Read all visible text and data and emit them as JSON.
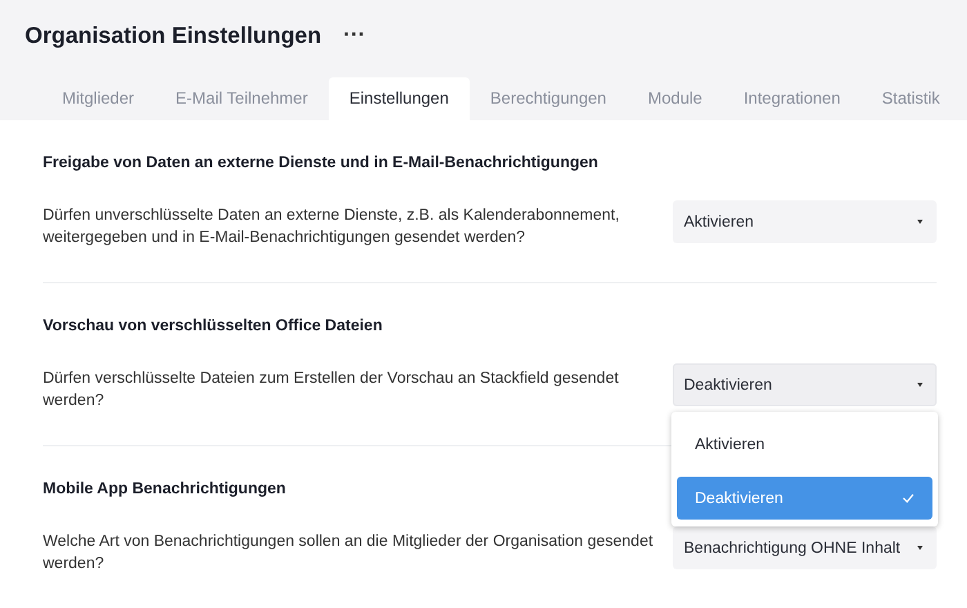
{
  "header": {
    "title": "Organisation Einstellungen",
    "more_icon": "···"
  },
  "tabs": [
    {
      "label": "Mitglieder",
      "selected": false
    },
    {
      "label": "E-Mail Teilnehmer",
      "selected": false
    },
    {
      "label": "Einstellungen",
      "selected": true
    },
    {
      "label": "Berechtigungen",
      "selected": false
    },
    {
      "label": "Module",
      "selected": false
    },
    {
      "label": "Integrationen",
      "selected": false
    },
    {
      "label": "Statistik",
      "selected": false
    }
  ],
  "sections": [
    {
      "title": "Freigabe von Daten an externe Dienste und in E-Mail-Benachrichtigungen",
      "question": "Dürfen unverschlüsselte Daten an externe Dienste, z.B. als Kalenderabonnement, weitergegeben und in E-Mail-Benachrichtigungen gesendet werden?",
      "select": {
        "value": "Aktivieren",
        "expanded": false
      }
    },
    {
      "title": "Vorschau von verschlüsselten Office Dateien",
      "question": "Dürfen verschlüsselte Dateien zum Erstellen der Vorschau an Stackfield gesendet werden?",
      "select": {
        "value": "Deaktivieren",
        "expanded": true,
        "options": [
          {
            "label": "Aktivieren",
            "selected": false
          },
          {
            "label": "Deaktivieren",
            "selected": true
          }
        ]
      }
    },
    {
      "title": "Mobile App Benachrichtigungen",
      "question": "Welche Art von Benachrichtigungen sollen an die Mitglieder der Organisation gesendet werden?",
      "select": {
        "value": "Benachrichtigung OHNE Inhalt",
        "expanded": false
      }
    }
  ]
}
